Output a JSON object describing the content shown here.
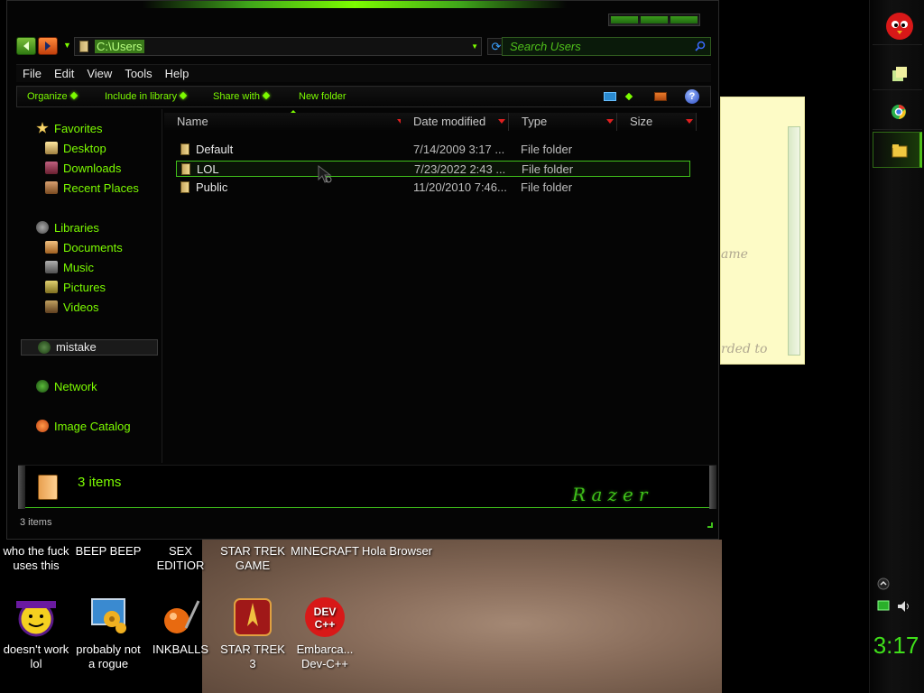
{
  "window": {
    "address": "C:\\Users",
    "search_placeholder": "Search Users",
    "menu": [
      "File",
      "Edit",
      "View",
      "Tools",
      "Help"
    ],
    "commands": [
      "Organize",
      "Include in library",
      "Share with",
      "New folder"
    ],
    "help_glyph": "?",
    "nav": {
      "favorites": "Favorites",
      "desktop": "Desktop",
      "downloads": "Downloads",
      "recent": "Recent Places",
      "libraries": "Libraries",
      "documents": "Documents",
      "music": "Music",
      "pictures": "Pictures",
      "videos": "Videos",
      "mistake": "mistake",
      "network": "Network",
      "image_catalog": "Image Catalog"
    },
    "columns": [
      "Name",
      "Date modified",
      "Type",
      "Size"
    ],
    "files": [
      {
        "name": "Default",
        "date": "7/14/2009 3:17 ...",
        "type": "File folder",
        "selected": false
      },
      {
        "name": "LOL",
        "date": "7/23/2022 2:43 ...",
        "type": "File folder",
        "selected": true
      },
      {
        "name": "Public",
        "date": "11/20/2010 7:46...",
        "type": "File folder",
        "selected": false
      }
    ],
    "details_count": "3 items",
    "brand": "Razer",
    "status": "3 items"
  },
  "sticky": {
    "line1": "ame",
    "line2": "rded to"
  },
  "desktop_icons": [
    {
      "label": "who the fuck uses this"
    },
    {
      "label": "BEEP BEEP"
    },
    {
      "label": "SEX EDITIOR"
    },
    {
      "label": "STAR TREK GAME"
    },
    {
      "label": "MINECRAFT"
    },
    {
      "label": "Hola Browser"
    },
    {
      "label": "doesn't work lol"
    },
    {
      "label": "probably not a rogue"
    },
    {
      "label": "INKBALLS"
    },
    {
      "label": "STAR TREK 3"
    },
    {
      "label": "Embarca... Dev-C++"
    }
  ],
  "devcpp_logo": "DEV C++",
  "clock": "3:17",
  "colors": {
    "accent": "#7CFC00",
    "background": "#000000"
  }
}
